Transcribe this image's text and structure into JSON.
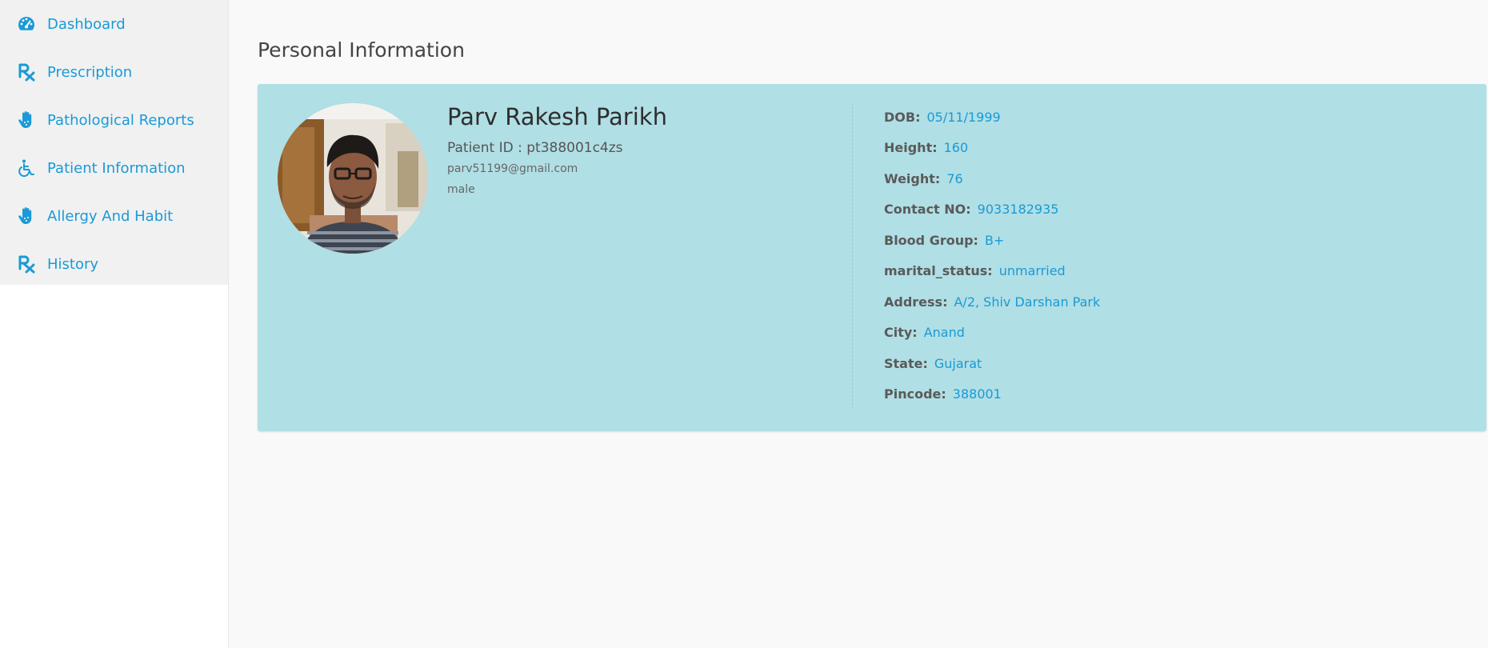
{
  "sidebar": {
    "items": [
      {
        "label": "Dashboard",
        "icon": "dashboard-icon"
      },
      {
        "label": "Prescription",
        "icon": "prescription-icon"
      },
      {
        "label": "Pathological Reports",
        "icon": "hand-icon"
      },
      {
        "label": "Patient Information",
        "icon": "wheelchair-icon"
      },
      {
        "label": "Allergy And Habit",
        "icon": "hand-icon"
      },
      {
        "label": "History",
        "icon": "prescription-icon"
      }
    ]
  },
  "main": {
    "title": "Personal Information"
  },
  "profile": {
    "name": "Parv Rakesh Parikh",
    "patient_id": "Patient ID : pt388001c4zs",
    "email": "parv51199@gmail.com",
    "gender": "male"
  },
  "details": [
    {
      "label": "DOB:",
      "value": "05/11/1999"
    },
    {
      "label": "Height:",
      "value": "160"
    },
    {
      "label": "Weight:",
      "value": "76"
    },
    {
      "label": "Contact NO:",
      "value": "9033182935"
    },
    {
      "label": "Blood Group:",
      "value": "B+"
    },
    {
      "label": "marital_status:",
      "value": "unmarried"
    },
    {
      "label": "Address:",
      "value": "A/2, Shiv Darshan Park"
    },
    {
      "label": "City:",
      "value": "Anand"
    },
    {
      "label": "State:",
      "value": "Gujarat"
    },
    {
      "label": "Pincode:",
      "value": "388001"
    }
  ],
  "colors": {
    "accent": "#1a9ad6",
    "card_bg": "#b0dfe5",
    "sidebar_bg": "#f1f1f1"
  }
}
